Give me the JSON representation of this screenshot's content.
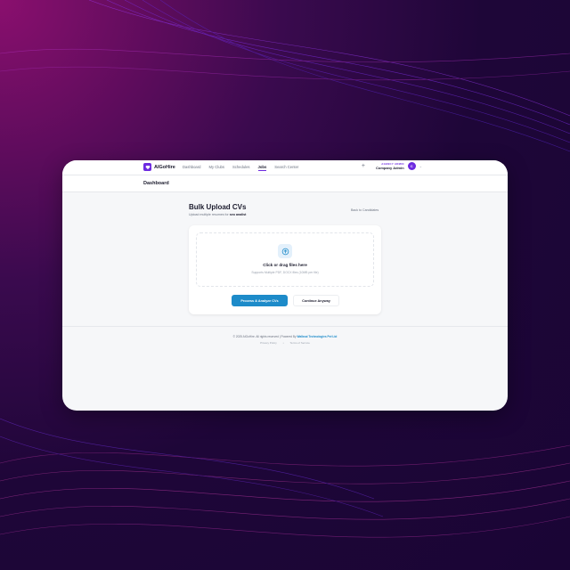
{
  "brand": {
    "name": "AIGoHire",
    "logo_icon": "heart-icon",
    "accent": "#6d2ae0"
  },
  "nav": {
    "links": [
      {
        "label": "Dashboard"
      },
      {
        "label": "My Clubs"
      },
      {
        "label": "Schedules"
      },
      {
        "label": "Jobs",
        "active": true
      },
      {
        "label": "Search Center"
      }
    ],
    "add_icon": "+",
    "user": {
      "role": "AGENCY ADMIN",
      "name": "Company Admin",
      "initial": "C"
    }
  },
  "subheader": {
    "title": "Dashboard"
  },
  "page": {
    "title": "Bulk Upload CVs",
    "subtitle_prefix": "Upload multiple resumes for",
    "subtitle_role": "seo analist",
    "back_link": "Back to Candidates"
  },
  "dropzone": {
    "title": "Click or drag files here",
    "hint": "Supports Multiple PDF, DOCX files (10MB per file)",
    "icon": "upload-icon"
  },
  "buttons": {
    "primary": "Process & Analyze CVs",
    "primary_color": "#1d8bc9",
    "secondary": "Continue Anyway"
  },
  "footer": {
    "copy_prefix": "© 2025 AIGoHire. All rights reserved | Powered By",
    "company": "Walbsai Technologies Pvt Ltd",
    "links": [
      "Privacy Policy",
      "Terms of Service"
    ],
    "separator": "•"
  }
}
